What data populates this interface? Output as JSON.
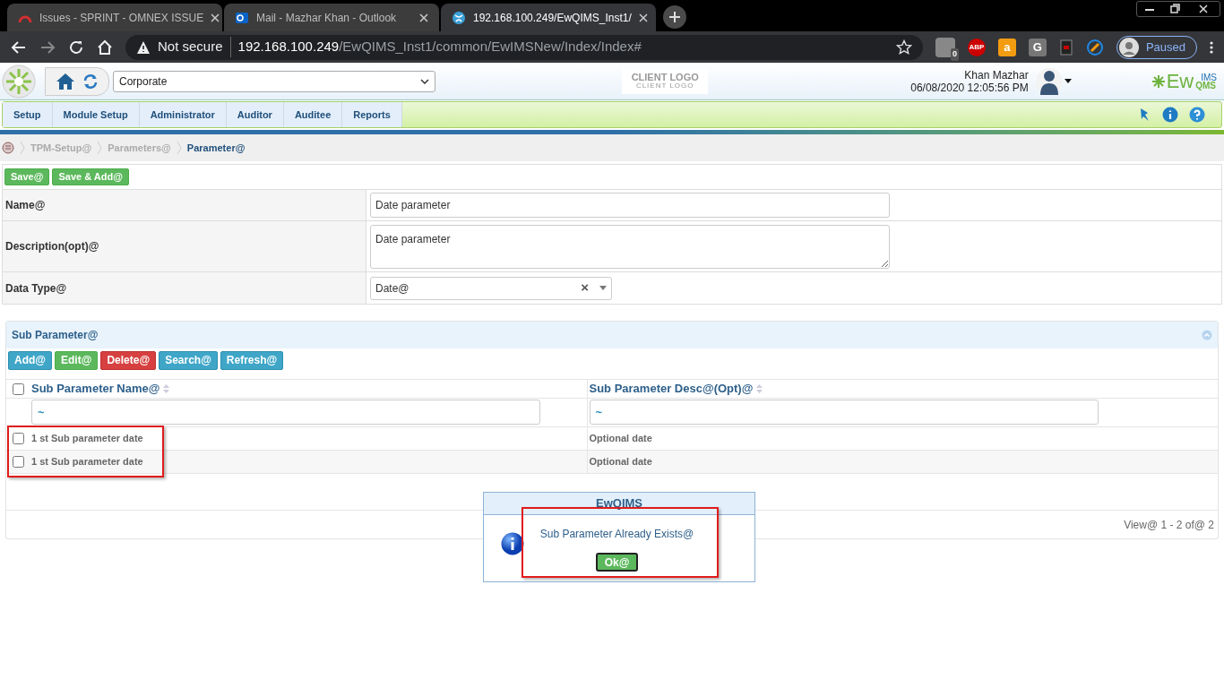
{
  "browser": {
    "tabs": [
      {
        "title": "Issues - SPRINT - OMNEX ISSUE",
        "selected": false
      },
      {
        "title": "Mail - Mazhar Khan - Outlook",
        "selected": false
      },
      {
        "title": "192.168.100.249/EwQIMS_Inst1/",
        "selected": true
      }
    ],
    "security": "Not secure",
    "host": "192.168.100.249",
    "path": "/EwQIMS_Inst1/common/EwIMSNew/Index/Index#",
    "extension_badge": "0",
    "extension_letters": [
      "ABP",
      "a",
      "G"
    ],
    "profile": "Paused"
  },
  "header": {
    "organization": "Corporate",
    "client_logo": "CLIENT LOGO",
    "client_logo_sub": "CLIENT LOGO",
    "user": "Khan Mazhar",
    "datetime": "06/08/2020 12:05:56 PM",
    "brand": "Ew",
    "brand_top": "IMS",
    "brand_bottom": "QMS"
  },
  "menu": [
    "Setup",
    "Module Setup",
    "Administrator",
    "Auditor",
    "Auditee",
    "Reports"
  ],
  "breadcrumb": [
    {
      "label": "TPM-Setup@",
      "current": false
    },
    {
      "label": "Parameters@",
      "current": false
    },
    {
      "label": "Parameter@",
      "current": true
    }
  ],
  "form": {
    "buttons": [
      "Save@",
      "Save & Add@"
    ],
    "fields": [
      {
        "label": "Name@",
        "kind": "text",
        "value": "Date parameter"
      },
      {
        "label": "Description(opt)@",
        "kind": "textarea",
        "value": "Date parameter"
      },
      {
        "label": "Data Type@",
        "kind": "select",
        "value": "Date@",
        "clear": "×"
      }
    ]
  },
  "sub_parameter": {
    "title": "Sub Parameter@",
    "buttons": [
      {
        "label": "Add@",
        "kind": "info"
      },
      {
        "label": "Edit@",
        "kind": "success"
      },
      {
        "label": "Delete@",
        "kind": "danger"
      },
      {
        "label": "Search@",
        "kind": "info"
      },
      {
        "label": "Refresh@",
        "kind": "info"
      }
    ],
    "columns": [
      "Sub Parameter Name@",
      "Sub Parameter Desc@(Opt)@"
    ],
    "all_checked": false,
    "filters": [
      "~",
      "~"
    ],
    "rows": [
      {
        "checked": false,
        "cells": [
          "1 st Sub parameter date",
          "Optional date"
        ]
      },
      {
        "checked": false,
        "cells": [
          "1 st Sub parameter date",
          "Optional date"
        ]
      }
    ],
    "rows_highlighted": true,
    "pager": "View@ 1 - 2 of@ 2"
  },
  "dialog": {
    "title": "EwQIMS",
    "message": "Sub Parameter Already Exists@",
    "button": "Ok@",
    "highlighted": true
  }
}
